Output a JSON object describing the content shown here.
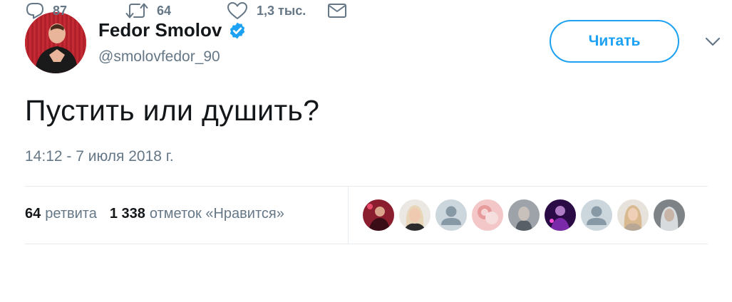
{
  "user": {
    "display_name": "Fedor Smolov",
    "handle": "@smolovfedor_90",
    "verified": true,
    "avatar_icon": "profile-photo"
  },
  "follow_button": {
    "label": "Читать"
  },
  "menu_icon": "chevron-down-icon",
  "tweet": {
    "text": "Пустить или душить?",
    "timestamp": "14:12 - 7 июля 2018 г."
  },
  "stats": {
    "retweets_count": "64",
    "retweets_label": "ретвита",
    "likes_count": "1 338",
    "likes_label": "отметок «Нравится»"
  },
  "likers": [
    {
      "icon": "user-avatar-photo"
    },
    {
      "icon": "user-avatar-photo"
    },
    {
      "icon": "default-avatar-icon"
    },
    {
      "icon": "user-avatar-photo"
    },
    {
      "icon": "user-avatar-photo"
    },
    {
      "icon": "user-avatar-photo"
    },
    {
      "icon": "default-avatar-icon"
    },
    {
      "icon": "user-avatar-photo"
    },
    {
      "icon": "user-avatar-photo"
    }
  ],
  "actions": {
    "reply_count": "87",
    "retweet_count": "64",
    "like_count": "1,3 тыс."
  },
  "colors": {
    "accent": "#1da1f2",
    "text_primary": "#14171a",
    "text_secondary": "#657786",
    "divider": "#e6ecf0"
  }
}
